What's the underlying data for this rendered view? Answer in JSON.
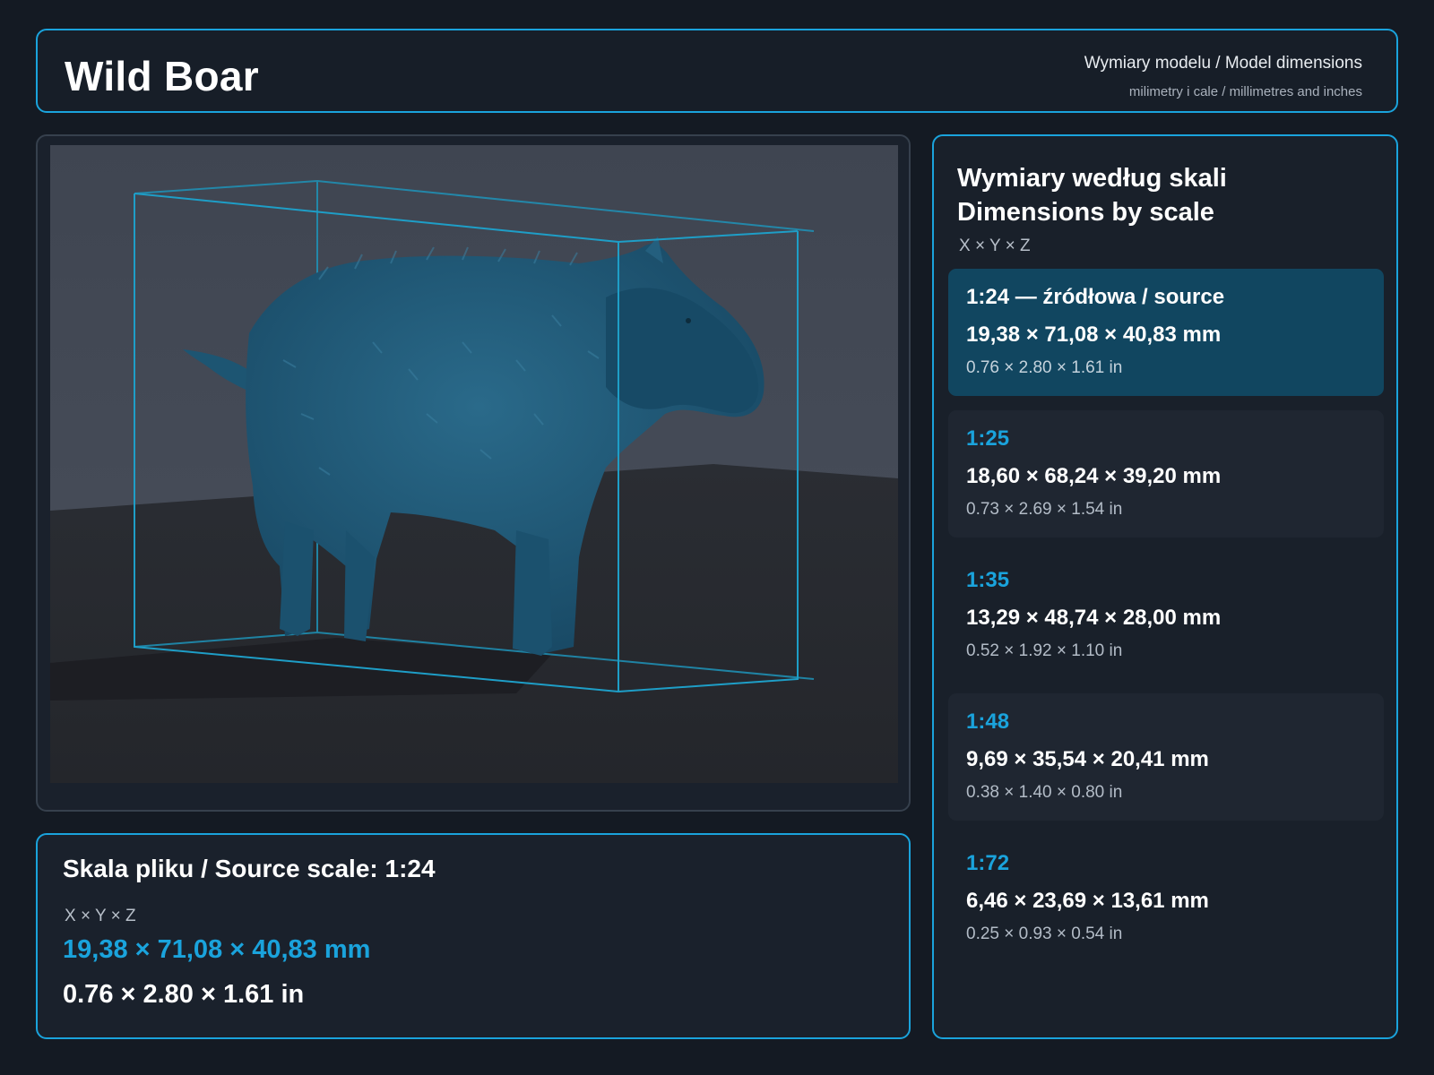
{
  "header": {
    "title": "Wild Boar",
    "subtitle": "Wymiary modelu / Model dimensions",
    "units": "milimetry i cale / millimetres and inches"
  },
  "source": {
    "heading": "Skala pliku / Source scale: 1:24",
    "axes": "X × Y × Z",
    "mm": "19,38 × 71,08 × 40,83 mm",
    "in": "0.76 × 2.80 × 1.61 in"
  },
  "scales_panel": {
    "title_line1": "Wymiary według skali",
    "title_line2": "Dimensions by scale",
    "axes": "X × Y × Z",
    "items": [
      {
        "label": "1:24  —  źródłowa / source",
        "mm": "19,38 × 71,08 × 40,83 mm",
        "in": "0.76 × 2.80 × 1.61 in",
        "active": true
      },
      {
        "label": "1:25",
        "mm": "18,60 × 68,24 × 39,20 mm",
        "in": "0.73 × 2.69 × 1.54 in",
        "active": false
      },
      {
        "label": "1:35",
        "mm": "13,29 × 48,74 × 28,00 mm",
        "in": "0.52 × 1.92 × 1.10 in",
        "active": false
      },
      {
        "label": "1:48",
        "mm": "9,69 × 35,54 × 20,41 mm",
        "in": "0.38 × 1.40 × 0.80 in",
        "active": false
      },
      {
        "label": "1:72",
        "mm": "6,46 × 23,69 × 13,61 mm",
        "in": "0.25 × 0.93 × 0.54 in",
        "active": false
      }
    ]
  },
  "colors": {
    "accent": "#1aa3dc",
    "active_card": "#114660",
    "model": "#1f5673"
  },
  "icons": [
    "bounding-box-icon"
  ]
}
